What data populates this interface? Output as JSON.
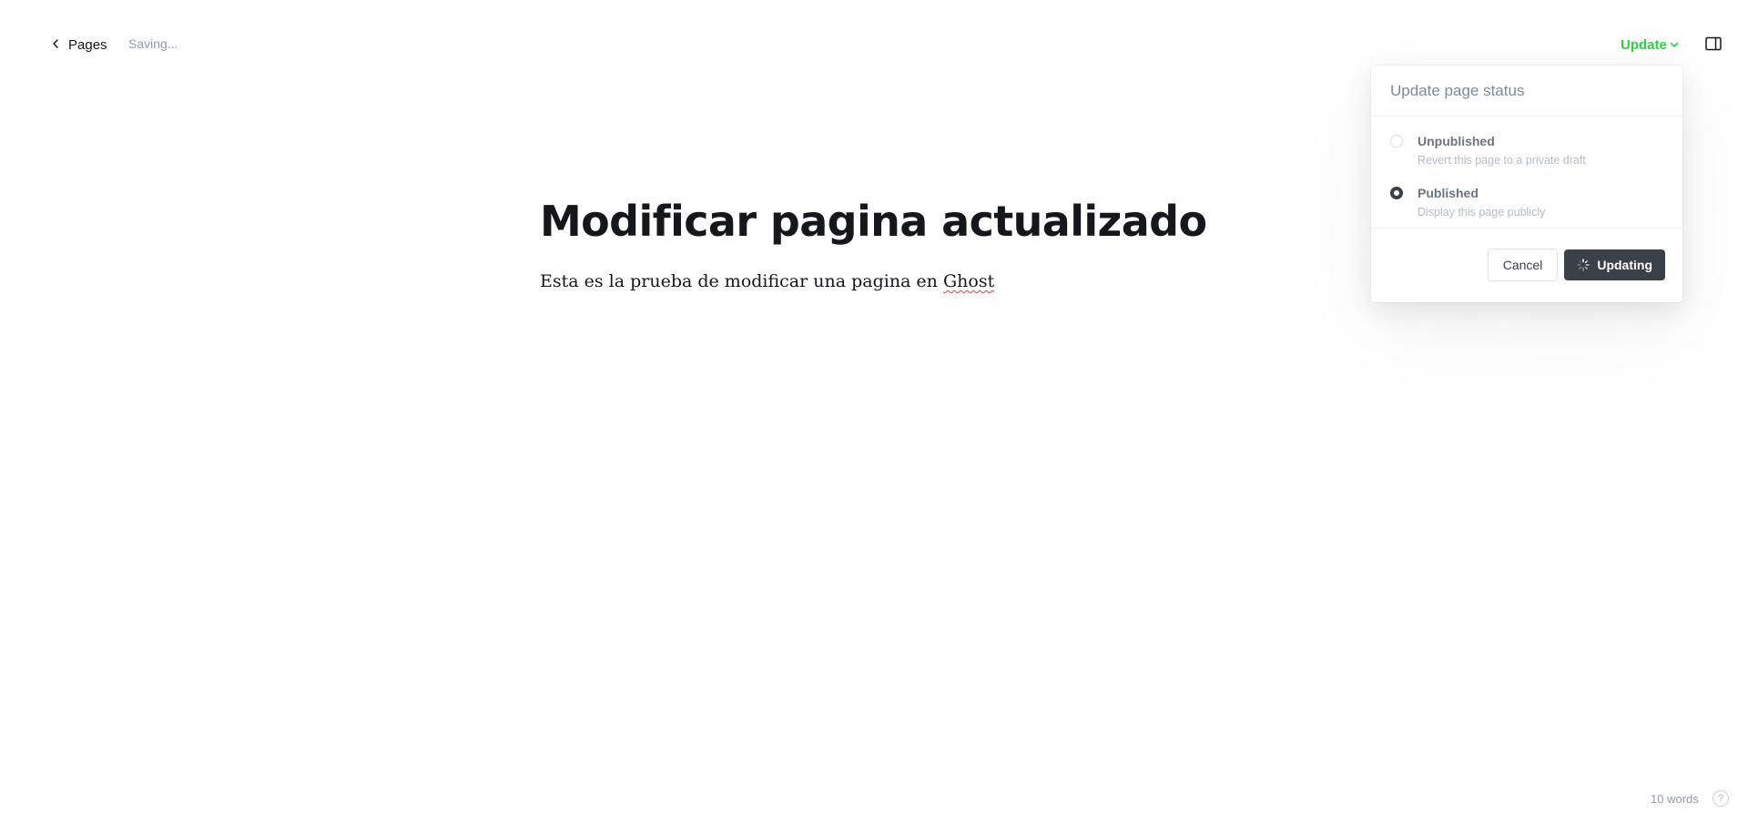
{
  "header": {
    "back_label": "Pages",
    "saving_status": "Saving...",
    "update_label": "Update"
  },
  "editor": {
    "title": "Modificar pagina actualizado",
    "body_text": "Esta es la prueba de modificar una pagina en ",
    "body_misspelled": "Ghost"
  },
  "publish_menu": {
    "title": "Update page status",
    "options": [
      {
        "label": "Unpublished",
        "description": "Revert this page to a private draft",
        "selected": false
      },
      {
        "label": "Published",
        "description": "Display this page publicly",
        "selected": true
      }
    ],
    "cancel_label": "Cancel",
    "submit_label": "Updating"
  },
  "footer": {
    "word_count": "10 words",
    "help_label": "?"
  },
  "icons": {
    "back": "chevron-left-icon",
    "update_dropdown": "chevron-down-icon",
    "sidebar": "sidebar-panel-icon",
    "spinner": "spinner-icon",
    "help": "question-mark-icon"
  },
  "colors": {
    "accent_green": "#30cf43",
    "dark_button": "#394047",
    "muted_text": "#8e9cac"
  }
}
